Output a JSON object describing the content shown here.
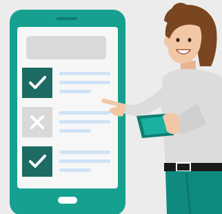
{
  "illustration": {
    "subject": "woman-pointing-at-phone-checklist",
    "checklist": [
      {
        "state": "checked",
        "icon": "checkmark-icon"
      },
      {
        "state": "unchecked",
        "icon": "x-mark-icon"
      },
      {
        "state": "checked",
        "icon": "checkmark-icon"
      }
    ]
  },
  "colors": {
    "background": "#ececec",
    "phone_body": "#16a08f",
    "phone_screen": "#f7f7f7",
    "phone_accent": "#1ab0a0",
    "check_box": "#1d6b63",
    "x_box": "#d9d9d9",
    "line_blue": "#cfe3f6",
    "hair": "#7a4521",
    "skin": "#f2c7a6",
    "shirt": "#dcdcdc",
    "belt": "#1a1a1a",
    "pants": "#0f8a7e",
    "tablet": "#0e7f73"
  }
}
